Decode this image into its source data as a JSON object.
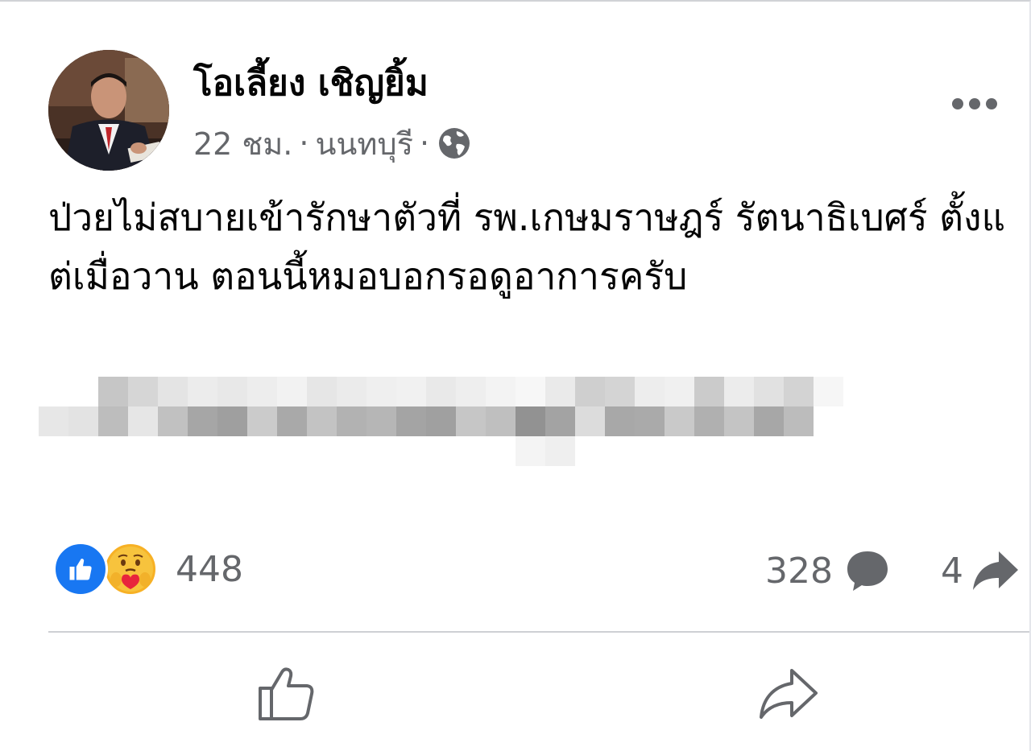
{
  "post": {
    "author": {
      "name": "โอเลี้ยง เชิญยิ้ม",
      "avatar_icon": "profile-photo"
    },
    "meta": {
      "time": "22 ชม.",
      "separator": "·",
      "location": "นนทบุรี",
      "privacy_icon": "globe-icon"
    },
    "more_icon": "more-options-icon",
    "text": "ป่วยไม่สบายเข้ารักษาตัวที่ รพ.เกษมราษฎร์ รัตนาธิเบศร์ ตั้งแต่เมื่อวาน ตอนนี้หมอบอกรอดูอาการครับ",
    "blurred_content": "pixelated-redacted-image"
  },
  "engagement": {
    "reaction_icons": [
      "like-reaction-icon",
      "care-reaction-icon"
    ],
    "reactions_count": "448",
    "comments_count": "328",
    "shares_count": "4"
  },
  "actions": {
    "like_icon": "thumbs-up-outline-icon",
    "share_icon": "share-arrow-outline-icon"
  },
  "colors": {
    "primary_text": "#050505",
    "secondary_text": "#65676b",
    "like_blue": "#1877f2",
    "care_yellow": "#f7b125",
    "divider": "#ced0d4"
  }
}
